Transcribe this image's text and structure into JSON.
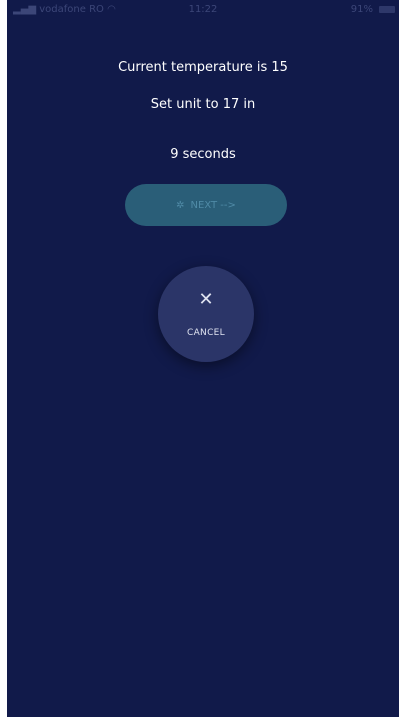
{
  "status_bar": {
    "carrier": "vodafone RO",
    "time": "11:22",
    "battery": "91%"
  },
  "instructions": {
    "current_temperature": "Current temperature is 15",
    "set_unit": "Set unit to 17 in",
    "countdown": "9 seconds"
  },
  "next_button": {
    "icon": "settings-icon",
    "label": "NEXT -->"
  },
  "cancel_button": {
    "icon": "close-icon",
    "label": "CANCEL"
  },
  "colors": {
    "background": "#111a4a",
    "next_button": "#2a5e78",
    "cancel_button": "#2b3568"
  }
}
